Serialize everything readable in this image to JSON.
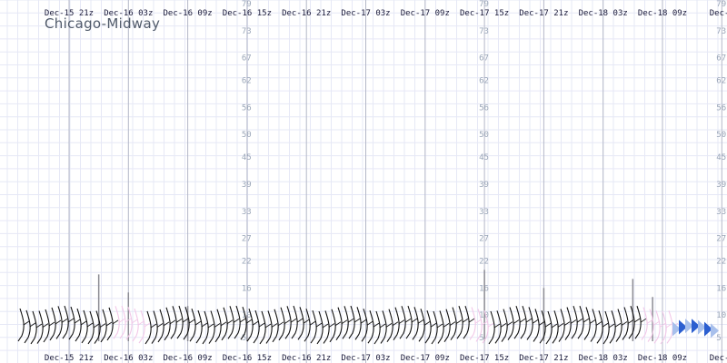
{
  "station": "Chicago-Midway",
  "chart_data": {
    "type": "line",
    "xlabel": "",
    "ylabel": "",
    "time_labels_top": [
      "Dec-15 21z",
      "Dec-16 03z",
      "Dec-16 09z",
      "Dec-16 15z",
      "Dec-16 21z",
      "Dec-17 03z",
      "Dec-17 09z",
      "Dec-17 15z",
      "Dec-17 21z",
      "Dec-18 03z",
      "Dec-18 09z",
      "Dec-1"
    ],
    "time_labels_bottom": [
      "Dec-15 21z",
      "Dec-16 03z",
      "Dec-16 09z",
      "Dec-16 15z",
      "Dec-16 21z",
      "Dec-17 03z",
      "Dec-17 09z",
      "Dec-17 15z",
      "Dec-17 21z",
      "Dec-18 03z",
      "Dec-18 09z",
      "Dec-1"
    ],
    "y_ticks": [
      5,
      10,
      16,
      22,
      27,
      33,
      39,
      45,
      50,
      56,
      62,
      67,
      73,
      79
    ],
    "y_axis_columns": [
      "Dec-16 15z",
      "Dec-17 15z",
      "Dec-18 15z"
    ],
    "gust_spikes": [
      {
        "time": "Dec-16 00z",
        "value": 19
      },
      {
        "time": "Dec-16 03z",
        "value": 15
      },
      {
        "time": "Dec-16 09z",
        "value": 12
      },
      {
        "time": "Dec-16 15z",
        "value": 10
      },
      {
        "time": "Dec-17 15z",
        "value": 20
      },
      {
        "time": "Dec-17 21z",
        "value": 16
      },
      {
        "time": "Dec-18 06z",
        "value": 18
      },
      {
        "time": "Dec-18 08z",
        "value": 14
      }
    ],
    "wind_barb_count": 110,
    "barb_colors": [
      "#111111",
      "#f2c8e8",
      "#a8c0ec",
      "#2c5fd0"
    ]
  }
}
